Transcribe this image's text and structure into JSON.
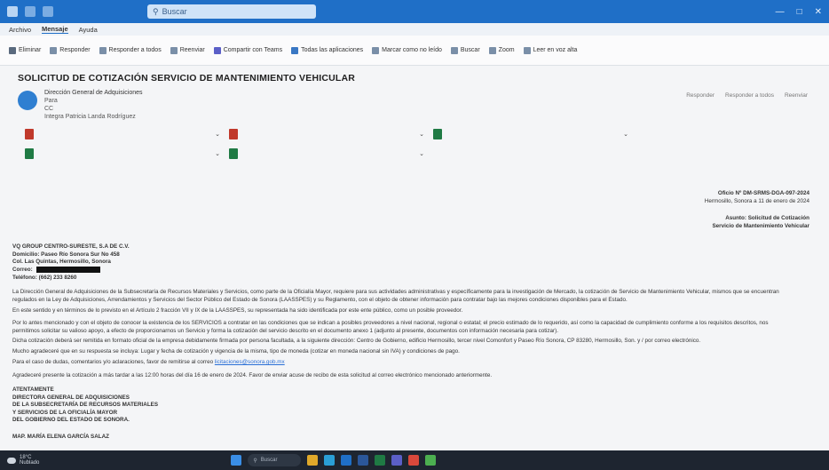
{
  "window": {
    "title": "",
    "search_placeholder": "Buscar"
  },
  "menu": [
    "Archivo",
    "Mensaje",
    "Ayuda"
  ],
  "ribbon": [
    "Eliminar",
    "Responder",
    "Responder a todos",
    "Reenviar",
    "Compartir con Teams",
    "Todas las aplicaciones",
    "Marcar como no leído",
    "Buscar",
    "Zoom",
    "Leer en voz alta"
  ],
  "email": {
    "subject": "SOLICITUD DE COTIZACIÓN SERVICIO DE MANTENIMIENTO VEHICULAR",
    "sender_name": "Dirección General de Adquisiciones",
    "recipients": [
      "Para",
      "CC",
      "Integra Patricia Landa Rodríguez"
    ],
    "actions": [
      "Responder",
      "Responder a todos",
      "Reenviar"
    ],
    "attachments": [
      "",
      "",
      "",
      "",
      ""
    ]
  },
  "doc": {
    "oficio": "Oficio Nº DM-SRMS-DGA-097-2024",
    "lugar_fecha": "Hermosillo, Sonora a 11 de enero de 2024",
    "asunto1": "Asunto: Solicitud de Cotización",
    "asunto2": "Servicio de Mantenimiento Vehicular",
    "dest_company": "VQ GROUP CENTRO-SURESTE, S.A DE C.V.",
    "dest_domicilio": "Domicilio: Paseo Río Sonora Sur No 458",
    "dest_col": "Col. Las Quintas, Hermosillo, Sonora",
    "dest_correo": "Correo:",
    "dest_tel": "Teléfono: (662) 233 8260",
    "p1": "La Dirección General de Adquisiciones de la Subsecretaría de Recursos Materiales y Servicios, como parte de la Oficialía Mayor, requiere para sus actividades administrativas y específicamente para la investigación de Mercado, la cotización de Servicio de Mantenimiento Vehicular, mismos que se encuentran",
    "p1b": "regulados en la Ley de Adquisiciones, Arrendamientos y Servicios del Sector Público del Estado de Sonora (LAASSPES) y su Reglamento, con el objeto de obtener información para contratar bajo las mejores condiciones disponibles para el Estado.",
    "p2": "En este sentido y en términos de lo previsto en el Artículo 2 fracción VII y IX de la LAASSPES, su representada ha sido identificada por este ente público, como un posible proveedor.",
    "p3": "Por lo antes mencionado y con el objeto de conocer la existencia de los SERVICIOS a contratar en las condiciones que se indican a posibles proveedores a nivel nacional, regional o estatal; el precio estimado de lo requerido, así como la capacidad de cumplimiento conforme a los requisitos descritos, nos",
    "p3b": "permitimos solicitar su valioso apoyo, a efecto de proporcionarnos un Servicio y forma la cotización del servicio descrito en el documento anexo 1 (adjunto al presente, documentos con información necesaria para cotizar).",
    "p4": "Dicha cotización deberá ser remitida en formato oficial de la empresa debidamente firmada por persona facultada, a la siguiente dirección: Centro de Gobierno, edificio Hermosillo, tercer nivel Comonfort y Paseo Río Sonora, CP 83280, Hermosillo, Son. y / por correo electrónico.",
    "p5": "Mucho agradeceré que en su respuesta se incluya: Lugar y fecha de cotización y vigencia de la misma, tipo de moneda (cotizar en moneda nacional sin IVA) y condiciones de pago.",
    "p6_pre": "Para el caso de dudas, comentarios y/o aclaraciones, favor de remitirse al correo",
    "p6_email": "licitaciones@sonora.gob.mx",
    "p7": "Agradeceré presente la cotización a más tardar a las 12:00 horas del día 16 de enero de 2024. Favor de enviar acuse de recibo de esta solicitud al correo electrónico mencionado anteriormente.",
    "atte": "ATENTAMENTE",
    "firma1": "DIRECTORA GENERAL DE ADQUISICIONES",
    "firma2": "DE LA SUBSECRETARÍA DE RECURSOS MATERIALES",
    "firma3": "Y SERVICIOS DE LA OFICIALÍA MAYOR",
    "firma4": "DEL GOBIERNO DEL ESTADO DE SONORA.",
    "firma_nombre": "MAP. MARÍA ELENA GARCÍA SALAZ"
  },
  "taskbar": {
    "weather_temp": "18°C",
    "weather_desc": "Nublado",
    "search": "Buscar",
    "time": "",
    "date": ""
  },
  "colors": {
    "titlebar": "#1f6fc7",
    "taskbar": "#1e2530",
    "link": "#2a6fd6"
  }
}
